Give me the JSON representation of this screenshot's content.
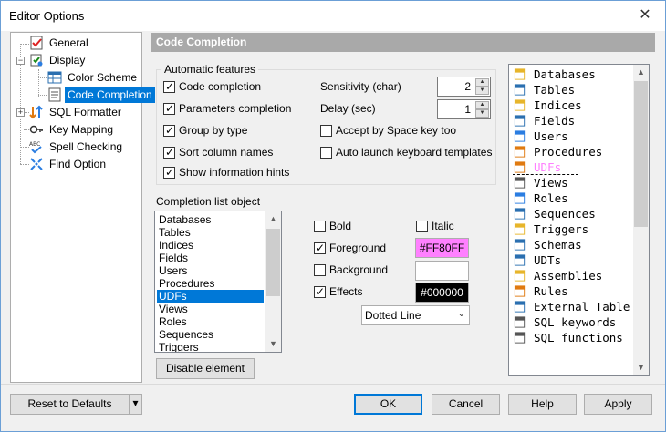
{
  "window": {
    "title": "Editor Options"
  },
  "tree": {
    "items": [
      {
        "label": "General",
        "icon": "checklist-icon"
      },
      {
        "label": "Display",
        "icon": "display-icon"
      },
      {
        "label": "Color Scheme",
        "icon": "grid-icon"
      },
      {
        "label": "Code Completion",
        "icon": "code-completion-icon"
      },
      {
        "label": "SQL Formatter",
        "icon": "sort-icon"
      },
      {
        "label": "Key Mapping",
        "icon": "key-icon"
      },
      {
        "label": "Spell Checking",
        "icon": "abc-check-icon"
      },
      {
        "label": "Find Option",
        "icon": "find-icon"
      }
    ],
    "expander_plus": "+",
    "expander_minus": "−"
  },
  "header": {
    "title": "Code Completion"
  },
  "auto": {
    "group_title": "Automatic features",
    "code_completion": "Code completion",
    "parameters_completion": "Parameters completion",
    "group_by_type": "Group by type",
    "sort_column_names": "Sort column names",
    "show_information_hints": "Show information hints",
    "sensitivity_label": "Sensitivity (char)",
    "sensitivity_value": "2",
    "delay_label": "Delay (sec)",
    "delay_value": "1",
    "accept_space": "Accept by Space key too",
    "auto_launch": "Auto launch keyboard templates",
    "checkmark": "✓",
    "arrow_up": "▲",
    "arrow_down": "▼"
  },
  "completion": {
    "title": "Completion list object",
    "items": [
      "Databases",
      "Tables",
      "Indices",
      "Fields",
      "Users",
      "Procedures",
      "UDFs",
      "Views",
      "Roles",
      "Sequences",
      "Triggers"
    ],
    "selected": "UDFs",
    "disable_button": "Disable element",
    "scroll_up": "▲",
    "scroll_down": "▼"
  },
  "style": {
    "bold": "Bold",
    "italic": "Italic",
    "foreground": "Foreground",
    "foreground_color": "#FF80FF",
    "background": "Background",
    "effects": "Effects",
    "effects_color": "#000000",
    "effect_type": "Dotted Line",
    "dropdown_arrow": "⌄"
  },
  "preview": {
    "items": [
      {
        "text": "Databases",
        "icon": "database-icon"
      },
      {
        "text": "Tables",
        "icon": "table-icon"
      },
      {
        "text": "Indices",
        "icon": "index-icon"
      },
      {
        "text": "Fields",
        "icon": "field-icon"
      },
      {
        "text": "Users",
        "icon": "user-icon"
      },
      {
        "text": "Procedures",
        "icon": "procedure-icon"
      },
      {
        "text": "UDFs",
        "icon": "udf-icon"
      },
      {
        "text": "Views",
        "icon": "view-icon"
      },
      {
        "text": "Roles",
        "icon": "role-icon"
      },
      {
        "text": "Sequences",
        "icon": "sequence-icon"
      },
      {
        "text": "Triggers",
        "icon": "trigger-icon"
      },
      {
        "text": "Schemas",
        "icon": "schema-icon"
      },
      {
        "text": "UDTs",
        "icon": "udt-icon"
      },
      {
        "text": "Assemblies",
        "icon": "assembly-icon"
      },
      {
        "text": "Rules",
        "icon": "rule-icon"
      },
      {
        "text": "External Table",
        "icon": "external-table-icon"
      },
      {
        "text": "SQL keywords",
        "icon": "sql-keyword-icon"
      },
      {
        "text": "SQL functions",
        "icon": "sql-function-icon"
      }
    ]
  },
  "footer": {
    "reset": "Reset to Defaults",
    "ok": "OK",
    "cancel": "Cancel",
    "help": "Help",
    "apply": "Apply",
    "split_arrow": "▾"
  }
}
